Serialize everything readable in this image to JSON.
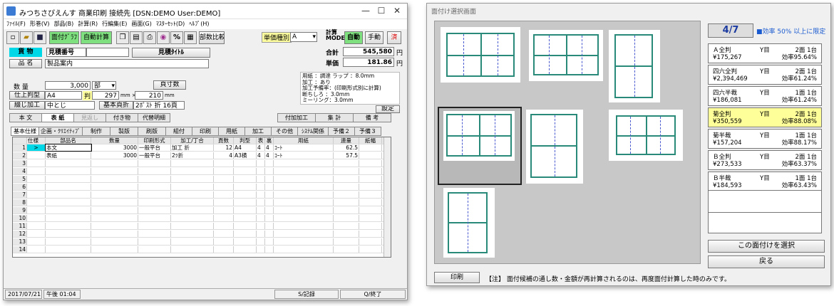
{
  "w1": {
    "title": "みつちさぴえんす 商業印刷 接続先 [DSN:DEMO User:DEMO]",
    "ctl": {
      "min": "—",
      "max": "☐",
      "close": "✕"
    },
    "menu": [
      "ﾌｧｲﾙ(F)",
      "形巻(V)",
      "部品(B)",
      "計算(R)",
      "行編集(E)",
      "画面(G)",
      "ﾏｽﾀｰｾｯﾄ(D)",
      "ﾍﾙﾌﾟ(H)"
    ],
    "toolbar": {
      "face_graph": "面付ｸﾞﾗﾌ",
      "auto_calc": "自動計算",
      "percent": "%",
      "dept_compare": "部数比較",
      "unit_kind_label": "単価種別",
      "unit_kind_value": "A",
      "calc_label": "計算\nMODE",
      "auto": "自動",
      "manual": "手動",
      "final": "済"
    },
    "kamoku": "貨 物",
    "mitsumori_no_label": "見積番号",
    "mitsumori_title_btn": "見積ﾀｲﾄﾙ",
    "gokei_label": "合計",
    "gokei_value": "545,580",
    "yen": "円",
    "tanka_label": "単価",
    "tanka_value": "181.86",
    "yen2": "円",
    "hinmei_label": "品 名",
    "hinmei_value": "製品案内",
    "suryo_label": "数 量",
    "suryo_value": "3,000",
    "suryo_unit": "部",
    "saishosu_btn": "頁寸数",
    "size_label": "仕上判型",
    "size_value": "A4",
    "han_label": "判",
    "w_val": "297",
    "mm_x": "mm ×",
    "h_val": "210",
    "mm": "mm",
    "toji_label": "綴じ加工",
    "toji_value": "中とじ",
    "kihon_label": "基本頁折",
    "kihon_value": "2ﾎﾟｽﾄ 折 16頁",
    "info": [
      "用紙   ：調達 ラップ   ：8.0mm",
      "加工   ：あり",
      "加工予備率：(印刷形式別に計算)",
      "断ちしろ ：3.0mm",
      "ミーリング：3.0mm"
    ],
    "settei_btn": "設定",
    "tabs1": [
      "本 文",
      "表 紙",
      "見返し",
      "付き物",
      "代替明細"
    ],
    "tabs1b": [
      "付加加工",
      "集 計",
      "備 考"
    ],
    "tabs2": [
      "基本仕様",
      "企画・ｸﾘｴｲﾃｨﾌﾞ",
      "制作",
      "製版",
      "刷版",
      "組付",
      "印刷",
      "用紙",
      "加工",
      "その他",
      "ｼｽﾃﾑ関係",
      "予備２",
      "予備３"
    ],
    "cols": [
      "",
      "仕様",
      "部品名",
      "数量",
      "印刷形式",
      "加工/丁合",
      "頁数",
      "判型",
      "表",
      "裏",
      "用紙",
      "連量",
      "紙幅"
    ],
    "rows": [
      [
        "1",
        ">",
        "本文",
        "3000",
        "一般平台",
        "加工 折",
        "12",
        "A4",
        "4",
        "4",
        "ｺｰﾄ",
        "62.5",
        ""
      ],
      [
        "2",
        "",
        "表紙",
        "3000",
        "一般平台",
        "2ﾂ折",
        "4",
        "A3横",
        "4",
        "4",
        "ｺｰﾄ",
        "57.5",
        ""
      ],
      [
        "3"
      ],
      [
        "4"
      ],
      [
        "5"
      ],
      [
        "6"
      ],
      [
        "7"
      ],
      [
        "8"
      ],
      [
        "9"
      ],
      [
        "10"
      ],
      [
        "11"
      ],
      [
        "12"
      ],
      [
        "13"
      ],
      [
        "14"
      ]
    ],
    "status": {
      "date": "2017/07/21",
      "time": "午後 01:04",
      "s_rec": "S/記録",
      "q_end": "Q/終了"
    }
  },
  "w2": {
    "title": "面付け選択画面",
    "counter": "4/7",
    "filter": "■効率 50% 以上に限定",
    "options": [
      {
        "name": "Ａ全判",
        "price": "¥175,267",
        "mark": "Y目",
        "f": "2面 1台",
        "eff": "効率95.64%"
      },
      {
        "name": "四六全判",
        "price": "¥2,394,469",
        "mark": "Y目",
        "f": "2面 1台",
        "eff": "効率61.24%"
      },
      {
        "name": "四六半裁",
        "price": "¥186,081",
        "mark": "Y目",
        "f": "1面 1台",
        "eff": "効率61.24%"
      },
      {
        "name": "菊全判",
        "price": "¥350,559",
        "mark": "Y目",
        "f": "2面 1台",
        "eff": "効率88.08%"
      },
      {
        "name": "菊半裁",
        "price": "¥157,204",
        "mark": "Y目",
        "f": "1面 1台",
        "eff": "効率88.17%"
      },
      {
        "name": "Ｂ全判",
        "price": "¥273,533",
        "mark": "Y目",
        "f": "2面 1台",
        "eff": "効率63.37%"
      },
      {
        "name": "Ｂ半裁",
        "price": "¥184,593",
        "mark": "Y目",
        "f": "1面 1台",
        "eff": "効率63.43%"
      }
    ],
    "select_btn": "この面付けを選択",
    "back_btn": "戻る",
    "print_btn": "印刷",
    "note": "【注】 面付候補の通し数・金額が再計算されるのは、再度面付計算した時のみです。",
    "colors": {
      "accent": "#2a8a7a",
      "highlight": "#ffff99"
    }
  }
}
